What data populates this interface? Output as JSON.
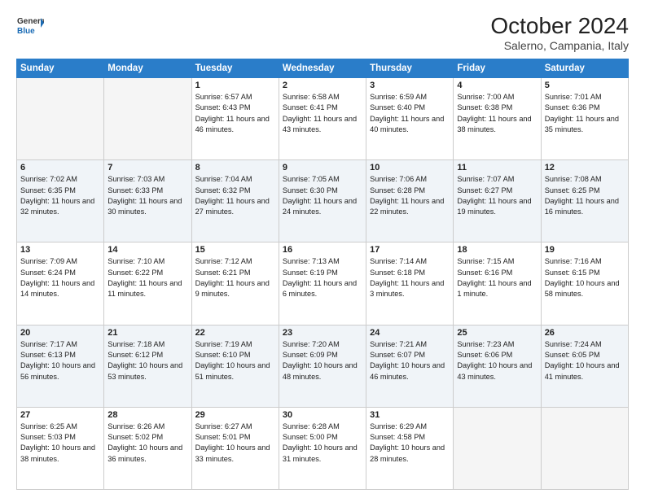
{
  "header": {
    "logo_line1": "General",
    "logo_line2": "Blue",
    "title": "October 2024",
    "subtitle": "Salerno, Campania, Italy"
  },
  "days_of_week": [
    "Sunday",
    "Monday",
    "Tuesday",
    "Wednesday",
    "Thursday",
    "Friday",
    "Saturday"
  ],
  "weeks": [
    [
      {
        "day": "",
        "empty": true
      },
      {
        "day": "",
        "empty": true
      },
      {
        "day": "1",
        "sunrise": "Sunrise: 6:57 AM",
        "sunset": "Sunset: 6:43 PM",
        "daylight": "Daylight: 11 hours and 46 minutes."
      },
      {
        "day": "2",
        "sunrise": "Sunrise: 6:58 AM",
        "sunset": "Sunset: 6:41 PM",
        "daylight": "Daylight: 11 hours and 43 minutes."
      },
      {
        "day": "3",
        "sunrise": "Sunrise: 6:59 AM",
        "sunset": "Sunset: 6:40 PM",
        "daylight": "Daylight: 11 hours and 40 minutes."
      },
      {
        "day": "4",
        "sunrise": "Sunrise: 7:00 AM",
        "sunset": "Sunset: 6:38 PM",
        "daylight": "Daylight: 11 hours and 38 minutes."
      },
      {
        "day": "5",
        "sunrise": "Sunrise: 7:01 AM",
        "sunset": "Sunset: 6:36 PM",
        "daylight": "Daylight: 11 hours and 35 minutes."
      }
    ],
    [
      {
        "day": "6",
        "sunrise": "Sunrise: 7:02 AM",
        "sunset": "Sunset: 6:35 PM",
        "daylight": "Daylight: 11 hours and 32 minutes."
      },
      {
        "day": "7",
        "sunrise": "Sunrise: 7:03 AM",
        "sunset": "Sunset: 6:33 PM",
        "daylight": "Daylight: 11 hours and 30 minutes."
      },
      {
        "day": "8",
        "sunrise": "Sunrise: 7:04 AM",
        "sunset": "Sunset: 6:32 PM",
        "daylight": "Daylight: 11 hours and 27 minutes."
      },
      {
        "day": "9",
        "sunrise": "Sunrise: 7:05 AM",
        "sunset": "Sunset: 6:30 PM",
        "daylight": "Daylight: 11 hours and 24 minutes."
      },
      {
        "day": "10",
        "sunrise": "Sunrise: 7:06 AM",
        "sunset": "Sunset: 6:28 PM",
        "daylight": "Daylight: 11 hours and 22 minutes."
      },
      {
        "day": "11",
        "sunrise": "Sunrise: 7:07 AM",
        "sunset": "Sunset: 6:27 PM",
        "daylight": "Daylight: 11 hours and 19 minutes."
      },
      {
        "day": "12",
        "sunrise": "Sunrise: 7:08 AM",
        "sunset": "Sunset: 6:25 PM",
        "daylight": "Daylight: 11 hours and 16 minutes."
      }
    ],
    [
      {
        "day": "13",
        "sunrise": "Sunrise: 7:09 AM",
        "sunset": "Sunset: 6:24 PM",
        "daylight": "Daylight: 11 hours and 14 minutes."
      },
      {
        "day": "14",
        "sunrise": "Sunrise: 7:10 AM",
        "sunset": "Sunset: 6:22 PM",
        "daylight": "Daylight: 11 hours and 11 minutes."
      },
      {
        "day": "15",
        "sunrise": "Sunrise: 7:12 AM",
        "sunset": "Sunset: 6:21 PM",
        "daylight": "Daylight: 11 hours and 9 minutes."
      },
      {
        "day": "16",
        "sunrise": "Sunrise: 7:13 AM",
        "sunset": "Sunset: 6:19 PM",
        "daylight": "Daylight: 11 hours and 6 minutes."
      },
      {
        "day": "17",
        "sunrise": "Sunrise: 7:14 AM",
        "sunset": "Sunset: 6:18 PM",
        "daylight": "Daylight: 11 hours and 3 minutes."
      },
      {
        "day": "18",
        "sunrise": "Sunrise: 7:15 AM",
        "sunset": "Sunset: 6:16 PM",
        "daylight": "Daylight: 11 hours and 1 minute."
      },
      {
        "day": "19",
        "sunrise": "Sunrise: 7:16 AM",
        "sunset": "Sunset: 6:15 PM",
        "daylight": "Daylight: 10 hours and 58 minutes."
      }
    ],
    [
      {
        "day": "20",
        "sunrise": "Sunrise: 7:17 AM",
        "sunset": "Sunset: 6:13 PM",
        "daylight": "Daylight: 10 hours and 56 minutes."
      },
      {
        "day": "21",
        "sunrise": "Sunrise: 7:18 AM",
        "sunset": "Sunset: 6:12 PM",
        "daylight": "Daylight: 10 hours and 53 minutes."
      },
      {
        "day": "22",
        "sunrise": "Sunrise: 7:19 AM",
        "sunset": "Sunset: 6:10 PM",
        "daylight": "Daylight: 10 hours and 51 minutes."
      },
      {
        "day": "23",
        "sunrise": "Sunrise: 7:20 AM",
        "sunset": "Sunset: 6:09 PM",
        "daylight": "Daylight: 10 hours and 48 minutes."
      },
      {
        "day": "24",
        "sunrise": "Sunrise: 7:21 AM",
        "sunset": "Sunset: 6:07 PM",
        "daylight": "Daylight: 10 hours and 46 minutes."
      },
      {
        "day": "25",
        "sunrise": "Sunrise: 7:23 AM",
        "sunset": "Sunset: 6:06 PM",
        "daylight": "Daylight: 10 hours and 43 minutes."
      },
      {
        "day": "26",
        "sunrise": "Sunrise: 7:24 AM",
        "sunset": "Sunset: 6:05 PM",
        "daylight": "Daylight: 10 hours and 41 minutes."
      }
    ],
    [
      {
        "day": "27",
        "sunrise": "Sunrise: 6:25 AM",
        "sunset": "Sunset: 5:03 PM",
        "daylight": "Daylight: 10 hours and 38 minutes."
      },
      {
        "day": "28",
        "sunrise": "Sunrise: 6:26 AM",
        "sunset": "Sunset: 5:02 PM",
        "daylight": "Daylight: 10 hours and 36 minutes."
      },
      {
        "day": "29",
        "sunrise": "Sunrise: 6:27 AM",
        "sunset": "Sunset: 5:01 PM",
        "daylight": "Daylight: 10 hours and 33 minutes."
      },
      {
        "day": "30",
        "sunrise": "Sunrise: 6:28 AM",
        "sunset": "Sunset: 5:00 PM",
        "daylight": "Daylight: 10 hours and 31 minutes."
      },
      {
        "day": "31",
        "sunrise": "Sunrise: 6:29 AM",
        "sunset": "Sunset: 4:58 PM",
        "daylight": "Daylight: 10 hours and 28 minutes."
      },
      {
        "day": "",
        "empty": true
      },
      {
        "day": "",
        "empty": true
      }
    ]
  ]
}
